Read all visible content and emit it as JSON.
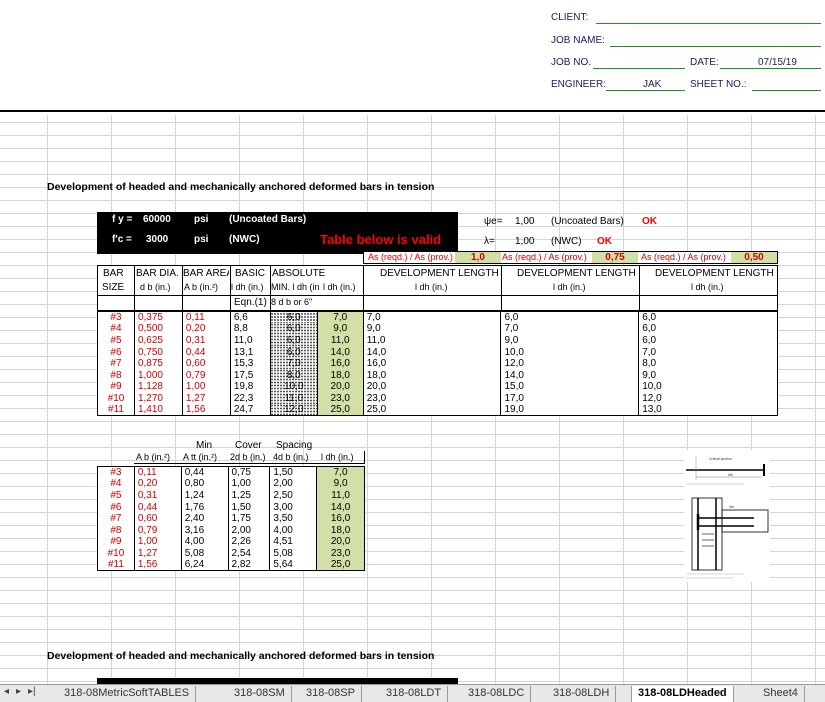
{
  "header": {
    "client_label": "CLIENT:",
    "job_name_label": "JOB NAME:",
    "job_no_label": "JOB NO.",
    "date_label": "DATE:",
    "date_value": "07/15/19",
    "engineer_label": "ENGINEER:",
    "engineer_value": "JAK",
    "sheet_no_label": "SHEET NO.:"
  },
  "section1": {
    "title": "Development of headed and mechanically anchored deformed bars in tension",
    "fy_label": "f y =",
    "fy_value": "60000",
    "fy_unit": "psi",
    "fy_note": "(Uncoated Bars)",
    "fc_label": "f'c =",
    "fc_value": "3000",
    "fc_unit": "psi",
    "fc_note": "(NWC)",
    "valid_note": "Table below is valid",
    "psi_e_label": "ψe=",
    "psi_e_value": "1,00",
    "psi_e_note": "(Uncoated Bars)",
    "psi_e_ok": "OK",
    "lambda_label": "λ=",
    "lambda_value": "1,00",
    "lambda_note": "(NWC)",
    "lambda_ok": "OK",
    "ratio_label": "As (reqd.) / As (prov.) =",
    "ratio1": "1,0",
    "ratio2": "0,75",
    "ratio3": "0,50"
  },
  "table1": {
    "headers": {
      "bar": "BAR",
      "size": "SIZE",
      "bar_dia": "BAR DIA.",
      "db": "d b (in.)",
      "bar_area": "BAR AREA",
      "ab": "A b (in.²)",
      "basic": "BASIC",
      "basic_sub": "l dh (in.)",
      "eqn": "Eqn.(1)",
      "absolute": "ABSOLUTE",
      "abs_min": "MIN. l dh (in.)",
      "abs_sub": "8 d b or 6\"",
      "ldh": "l dh (in.)",
      "dev_length": "DEVELOPMENT LENGTH",
      "dev_sub": "l dh (in.)"
    },
    "rows": [
      [
        "#3",
        "0,375",
        "0,11",
        "6,6",
        "6,0",
        "7,0",
        "7,0",
        "6,0",
        "6,0"
      ],
      [
        "#4",
        "0,500",
        "0,20",
        "8,8",
        "6,0",
        "9,0",
        "9,0",
        "7,0",
        "6,0"
      ],
      [
        "#5",
        "0,625",
        "0,31",
        "11,0",
        "6,0",
        "11,0",
        "11,0",
        "9,0",
        "6,0"
      ],
      [
        "#6",
        "0,750",
        "0,44",
        "13,1",
        "6,0",
        "14,0",
        "14,0",
        "10,0",
        "7,0"
      ],
      [
        "#7",
        "0,875",
        "0,60",
        "15,3",
        "7,0",
        "16,0",
        "16,0",
        "12,0",
        "8,0"
      ],
      [
        "#8",
        "1,000",
        "0,79",
        "17,5",
        "8,0",
        "18,0",
        "18,0",
        "14,0",
        "9,0"
      ],
      [
        "#9",
        "1,128",
        "1,00",
        "19,8",
        "10,0",
        "20,0",
        "20,0",
        "15,0",
        "10,0"
      ],
      [
        "#10",
        "1,270",
        "1,27",
        "22,3",
        "11,0",
        "23,0",
        "23,0",
        "17,0",
        "12,0"
      ],
      [
        "#11",
        "1,410",
        "1,56",
        "24,7",
        "12,0",
        "25,0",
        "25,0",
        "19,0",
        "13,0"
      ]
    ]
  },
  "table2": {
    "headers": {
      "min": "Min",
      "cover": "Cover",
      "spacing": "Spacing",
      "ab": "A b (in.²)",
      "att": "A tt (in.²)",
      "cover_sub": "2d b (in.)",
      "sp_sub": "4d b (in.)",
      "ldh": "l dh (in.)"
    },
    "rows": [
      [
        "#3",
        "0,11",
        "0,44",
        "0,75",
        "1,50",
        "7,0"
      ],
      [
        "#4",
        "0,20",
        "0,80",
        "1,00",
        "2,00",
        "9,0"
      ],
      [
        "#5",
        "0,31",
        "1,24",
        "1,25",
        "2,50",
        "11,0"
      ],
      [
        "#6",
        "0,44",
        "1,76",
        "1,50",
        "3,00",
        "14,0"
      ],
      [
        "#7",
        "0,60",
        "2,40",
        "1,75",
        "3,50",
        "16,0"
      ],
      [
        "#8",
        "0,79",
        "3,16",
        "2,00",
        "4,00",
        "18,0"
      ],
      [
        "#9",
        "1,00",
        "4,00",
        "2,26",
        "4,51",
        "20,0"
      ],
      [
        "#10",
        "1,27",
        "5,08",
        "2,54",
        "5,08",
        "23,0"
      ],
      [
        "#11",
        "1,56",
        "6,24",
        "2,82",
        "5,64",
        "25,0"
      ]
    ]
  },
  "figure": {
    "label1": "Critical section",
    "label2": "ldh"
  },
  "section2": {
    "title": "Development of headed and mechanically anchored deformed bars in tension"
  },
  "tabs": [
    "318-08MetricSoftTABLES",
    "318-08SM",
    "318-08SP",
    "318-08LDT",
    "318-08LDC",
    "318-08LDH",
    "318-08LDHeaded",
    "Sheet4"
  ],
  "active_tab": "318-08LDHeaded"
}
